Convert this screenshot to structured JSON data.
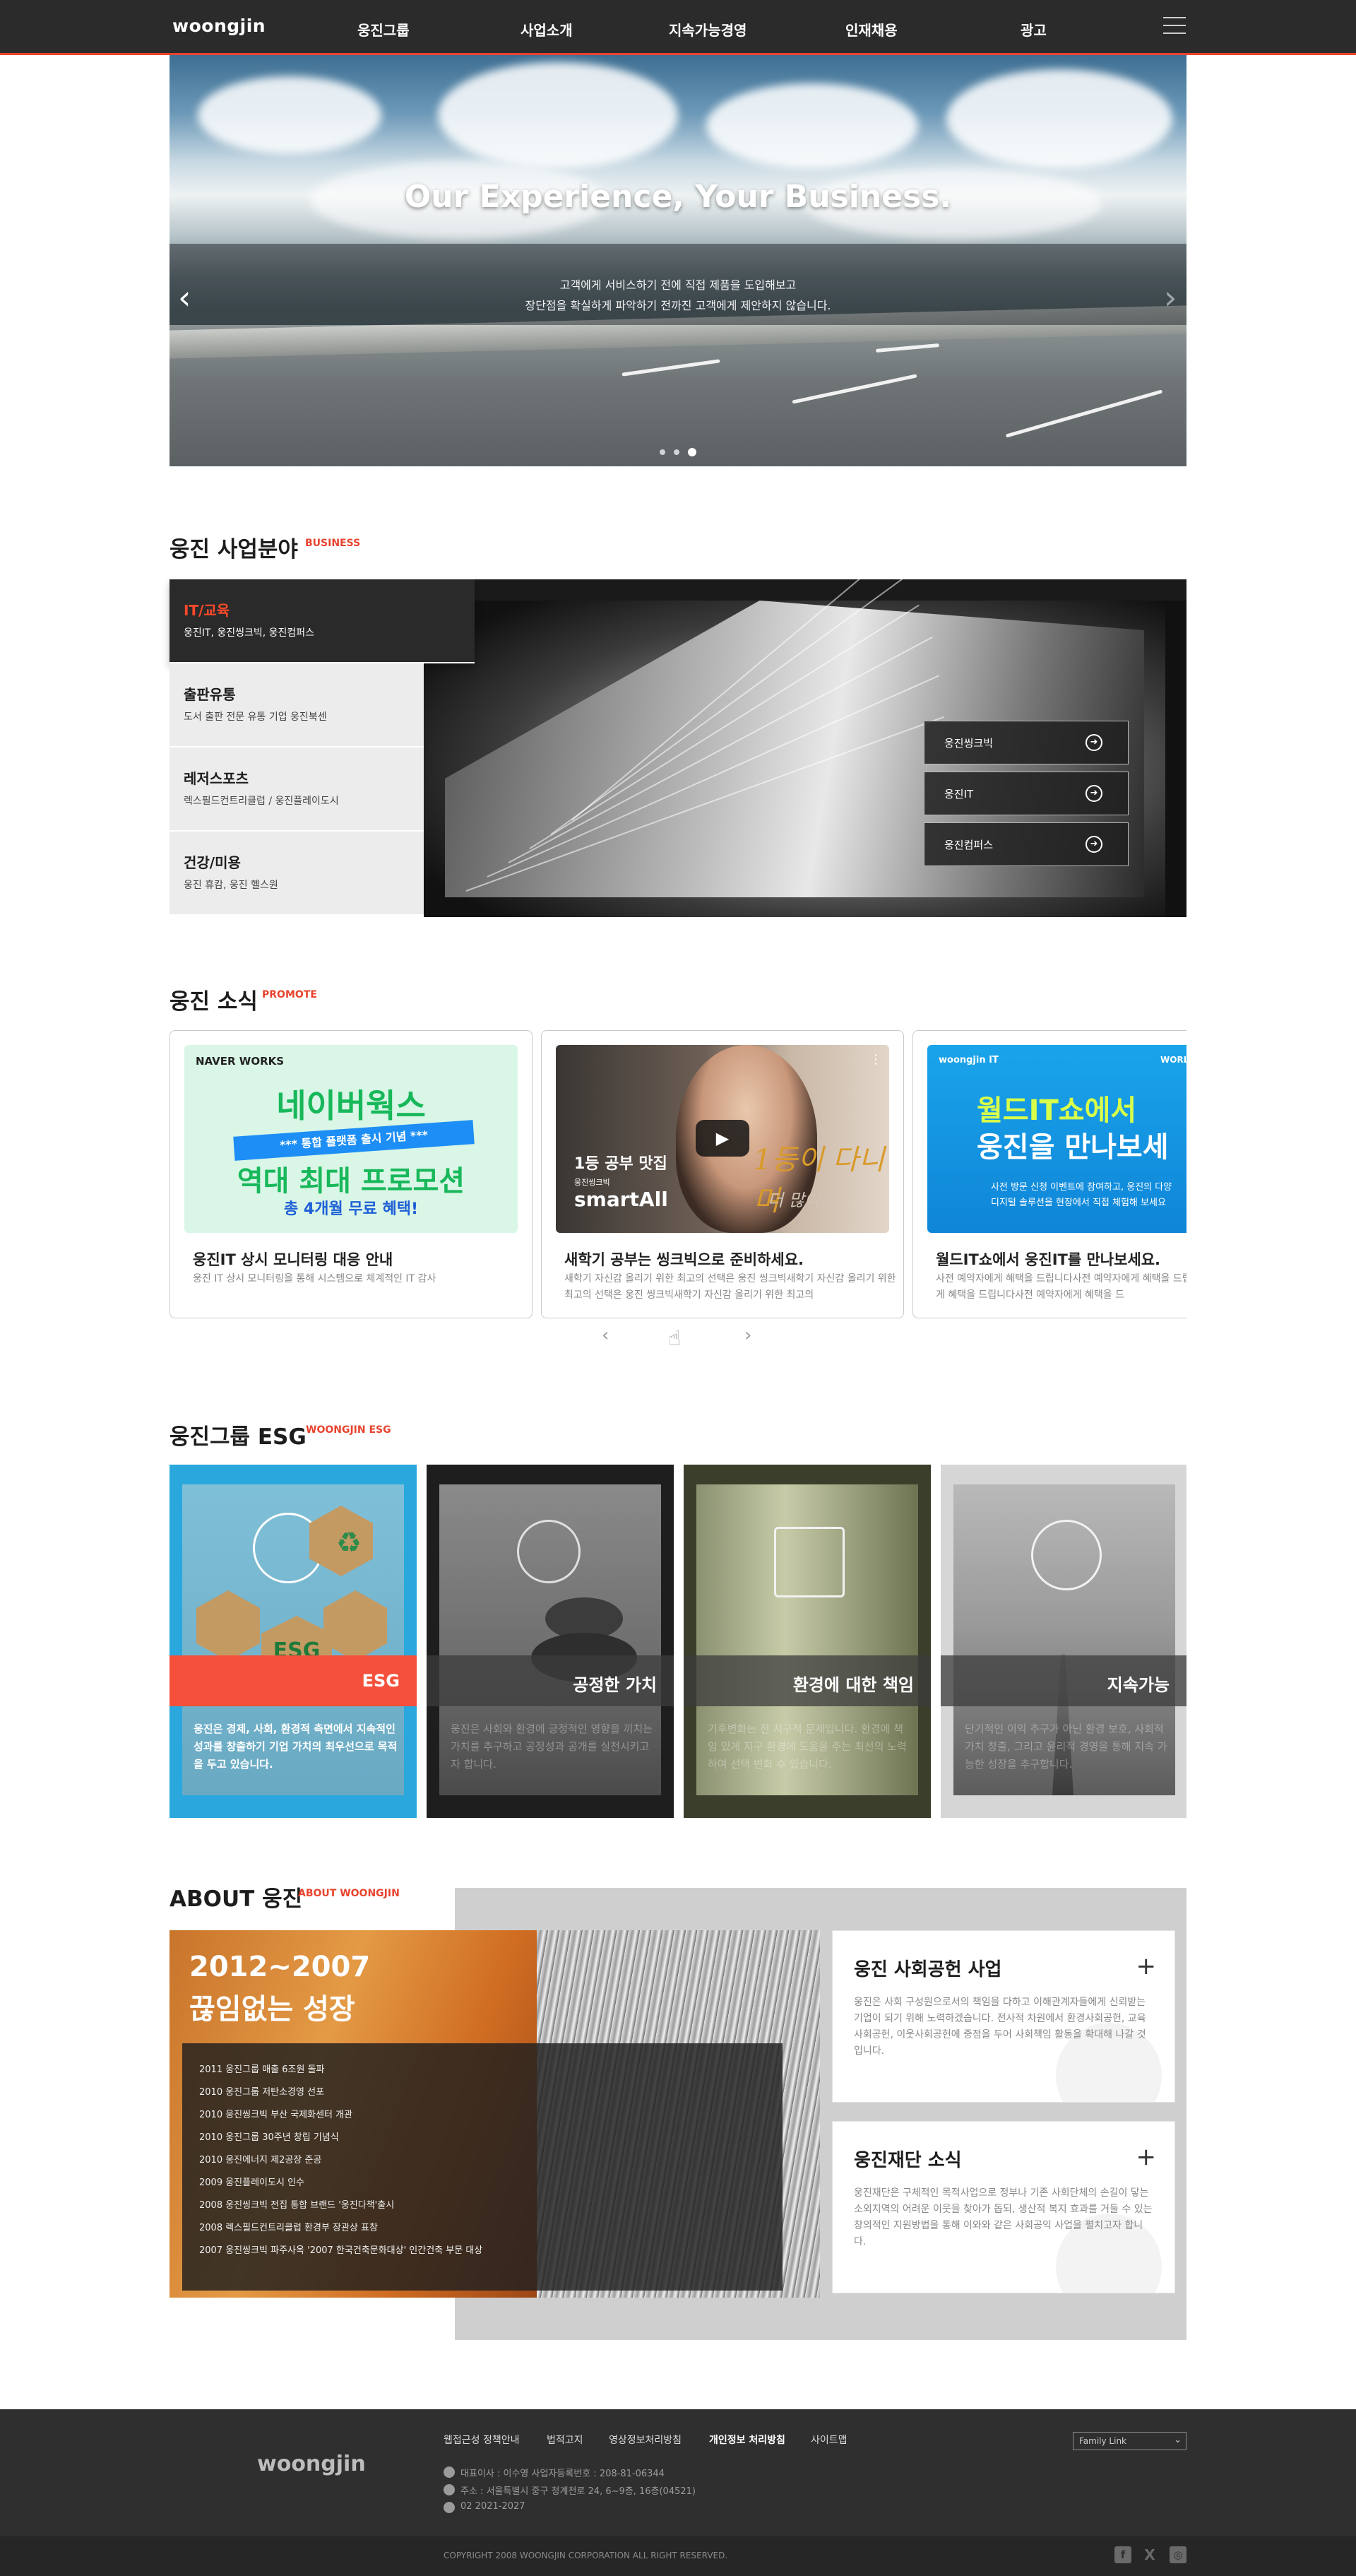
{
  "header": {
    "logo": "woongjin",
    "nav": [
      "웅진그룹",
      "사업소개",
      "지속가능경영",
      "인재채용",
      "광고"
    ]
  },
  "hero": {
    "title": "Our Experience, Your Business.",
    "sub1": "고객에게 서비스하기 전에 직접 제품을 도입해보고",
    "sub2": "장단점을 확실하게 파악하기 전까진 고객에게 제안하지 않습니다.",
    "prev": "‹",
    "next": "›",
    "slide_count": 3,
    "active_slide": 3
  },
  "business": {
    "title": "웅진 사업분야",
    "sub": "BUSINESS",
    "items": [
      {
        "title": "IT/교육",
        "desc": "웅진IT, 웅진씽크빅, 웅진컴퍼스"
      },
      {
        "title": "출판유통",
        "desc": "도서 출판 전문 유통 기업 웅진북센"
      },
      {
        "title": "레저스포츠",
        "desc": "렉스필드컨트리클럽 / 웅진플레이도시"
      },
      {
        "title": "건강/미용",
        "desc": "웅진 휴캄, 웅진 헬스원"
      }
    ],
    "buttons": [
      "웅진씽크빅",
      "웅진IT",
      "웅진컴퍼스"
    ]
  },
  "news": {
    "title": "웅진 소식",
    "sub": "PROMOTE",
    "cards": [
      {
        "img_brand": "NAVER WORKS",
        "img_line1": "네이버웍스",
        "img_ribbon": "*** 통합 플랫폼 출시 기념 ***",
        "img_line2": "역대 최대 프로모션",
        "img_line3": "총 4개월 무료 혜택!",
        "title": "웅진IT 상시 모니터링 대응 안내",
        "desc": "웅진 IT 상시 모니터링을 통해 시스템으로 체계적인 IT 감사"
      },
      {
        "img_line1": "1등 공부 맛집",
        "img_small": "웅진씽크빅",
        "img_brand": "smartAll",
        "img_script": "1등이 다니며",
        "img_script2": "더 많이네",
        "title": "새학기 공부는 씽크빅으로 준비하세요.",
        "desc": "새학기 자신감 올리기 위한 최고의 선택은 웅진 씽크빅새학기 자신감 올리기 위한 최고의 선택은 웅진 씽크빅새학기 자신감 올리기 위한 최고의"
      },
      {
        "img_brand": "woongjin IT",
        "img_brand2": "WORLD",
        "img_line1": "월드IT쇼에서",
        "img_line2": "웅진을 만나보세",
        "img_line3": "사전 방문 신청 이벤트에 참여하고, 웅진의 다양",
        "img_line4": "디지털 솔루션을 현장에서 직접 체험해 보세요",
        "title": "월드IT쇼에서 웅진IT를 만나보세요.",
        "desc": "사전 예약자에게 혜택을 드립니다사전 예약자에게 혜택을 드립니다사전 예약자에게 혜택을 드립니다사전 예약자에게 혜택을 드"
      }
    ],
    "controls": {
      "prev": "‹",
      "next": "›",
      "swipe": "☝"
    }
  },
  "esg": {
    "title": "웅진그룹 ESG",
    "sub": "WOONGJIN ESG",
    "cards": [
      {
        "label": "ESG",
        "img_text": "ESG",
        "text": "웅진은 경제, 사회, 환경적 측면에서 지속적인 성과를 창출하기 기업 가치의 최우선으로 목적을 두고 있습니다."
      },
      {
        "label": "공정한 가치",
        "text": "웅진은 사회와 환경에 긍정적인 영향을 끼치는 가치를 추구하고 공정성과 공개를 실천시키고자 합니다."
      },
      {
        "label": "환경에 대한 책임",
        "text": "기후변화는 전 지구적 문제입니다. 환경에 책임 있게 지구 환경에 도움을 주는 최선의 노력하여 선택 변화 수 있습니다."
      },
      {
        "label": "지속가능",
        "text": "단기적인 이익 추구가 아닌 환경 보호, 사회적 가치 창출, 그리고 윤리적 경영을 통해 지속 가능한 성장을 추구합니다."
      }
    ]
  },
  "about": {
    "title": "ABOUT 웅진",
    "sub": "ABOUT WOONGJIN",
    "year_range": "2012~2007",
    "headline": "끊임없는 성장",
    "history": [
      "2011 웅진그룹 매출 6조원 돌파",
      "2010 웅진그룹 저탄소경영 선포",
      "2010 웅진씽크빅 부산 국제화센터 개관",
      "2010 웅진그룹 30주년 창립 기념식",
      "2010 웅진에너지 제2공장 준공",
      "2009 웅진플레이도시 인수",
      "2008 웅진씽크빅 전집 통합 브랜드 '웅진다책'출시",
      "2008 렉스필드컨트리클럽 환경부 장관상 표창",
      "2007 웅진씽크빅 파주사옥 '2007 한국건축문화대상' 인간건축 부문 대상"
    ],
    "boxes": [
      {
        "title": "웅진 사회공헌 사업",
        "plus": "+",
        "text": "웅진은 사회 구성원으로서의 책임을 다하고 이해관계자들에게 신뢰받는 기업이 되기 위해 노력하겠습니다. 전사적 차원에서 환경사회공헌, 교육사회공헌, 이웃사회공헌에 중점을 두어 사회책임 활동을 확대해 나갈 것입니다."
      },
      {
        "title": "웅진재단 소식",
        "plus": "+",
        "text": "웅진재단은 구체적인 목적사업으로 정부나 기존 사회단체의 손길이 닿는 소외지역의 어려운 이웃을 찾아가 돕되, 생산적 복지 효과를 거둘 수 있는 창의적인 지원방법을 통해 이와와 같은 사회공익 사업을 펼치고자 합니다."
      }
    ]
  },
  "footer": {
    "logo": "woongjin",
    "links": [
      "웹접근성 정책안내",
      "법적고지",
      "영상정보처리방침",
      "개인정보 처리방침",
      "사이트맵"
    ],
    "info": [
      "대표이사 : 이수영 사업자등록번호 : 208-81-06344",
      "주소 : 서울특별시 중구 청계천로 24, 6~9층, 16층(04521)",
      "02 2021-2027"
    ],
    "family_link": "Family Link",
    "copyright": "COPYRIGHT 2008 WOONGJIN CORPORATION ALL RIGHT RESERVED.",
    "sns": [
      "f",
      "X",
      "◎"
    ]
  }
}
